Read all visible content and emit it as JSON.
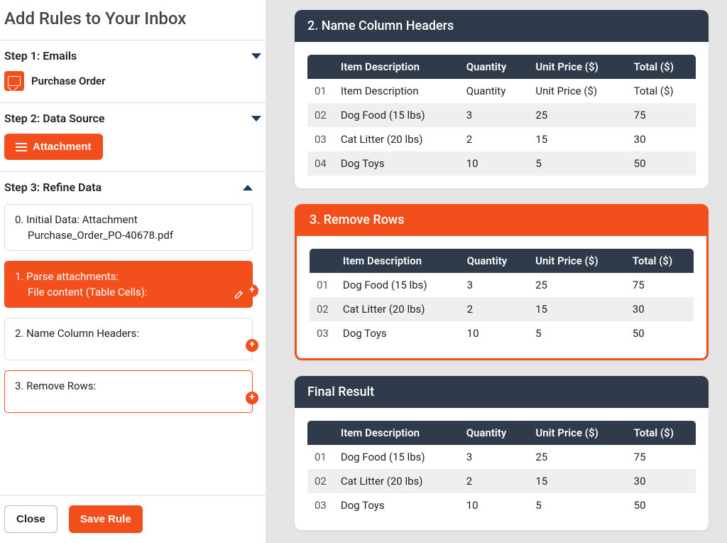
{
  "sidebar": {
    "title": "Add Rules to Your Inbox",
    "step1": {
      "title": "Step 1: Emails",
      "item": "Purchase Order"
    },
    "step2": {
      "title": "Step 2: Data Source",
      "button": "Attachment"
    },
    "step3": {
      "title": "Step 3: Refine Data",
      "items": [
        {
          "line1": "0. Initial Data: Attachment",
          "line2": "Purchase_Order_PO-40678.pdf"
        },
        {
          "line1": "1. Parse attachments:",
          "line2": "File content (Table Cells):"
        },
        {
          "line1": "2. Name Column Headers:"
        },
        {
          "line1": "3. Remove Rows:"
        }
      ]
    },
    "close": "Close",
    "save": "Save Rule"
  },
  "cards": [
    {
      "title": "2. Name Column Headers",
      "headers": [
        "",
        "Item Description",
        "Quantity",
        "Unit Price ($)",
        "Total ($)"
      ],
      "rows": [
        [
          "01",
          "Item Description",
          "Quantity",
          "Unit Price ($)",
          "Total ($)"
        ],
        [
          "02",
          "Dog Food (15 lbs)",
          "3",
          "25",
          "75"
        ],
        [
          "03",
          "Cat Litter (20 lbs)",
          "2",
          "15",
          "30"
        ],
        [
          "04",
          "Dog Toys",
          "10",
          "5",
          "50"
        ]
      ]
    },
    {
      "title": "3. Remove Rows",
      "headers": [
        "",
        "Item Description",
        "Quantity",
        "Unit Price ($)",
        "Total ($)"
      ],
      "rows": [
        [
          "01",
          "Dog Food (15 lbs)",
          "3",
          "25",
          "75"
        ],
        [
          "02",
          "Cat Litter (20 lbs)",
          "2",
          "15",
          "30"
        ],
        [
          "03",
          "Dog Toys",
          "10",
          "5",
          "50"
        ]
      ]
    },
    {
      "title": "Final Result",
      "headers": [
        "",
        "Item Description",
        "Quantity",
        "Unit Price ($)",
        "Total ($)"
      ],
      "rows": [
        [
          "01",
          "Dog Food (15 lbs)",
          "3",
          "25",
          "75"
        ],
        [
          "02",
          "Cat Litter (20 lbs)",
          "2",
          "15",
          "30"
        ],
        [
          "03",
          "Dog Toys",
          "10",
          "5",
          "50"
        ]
      ]
    }
  ]
}
